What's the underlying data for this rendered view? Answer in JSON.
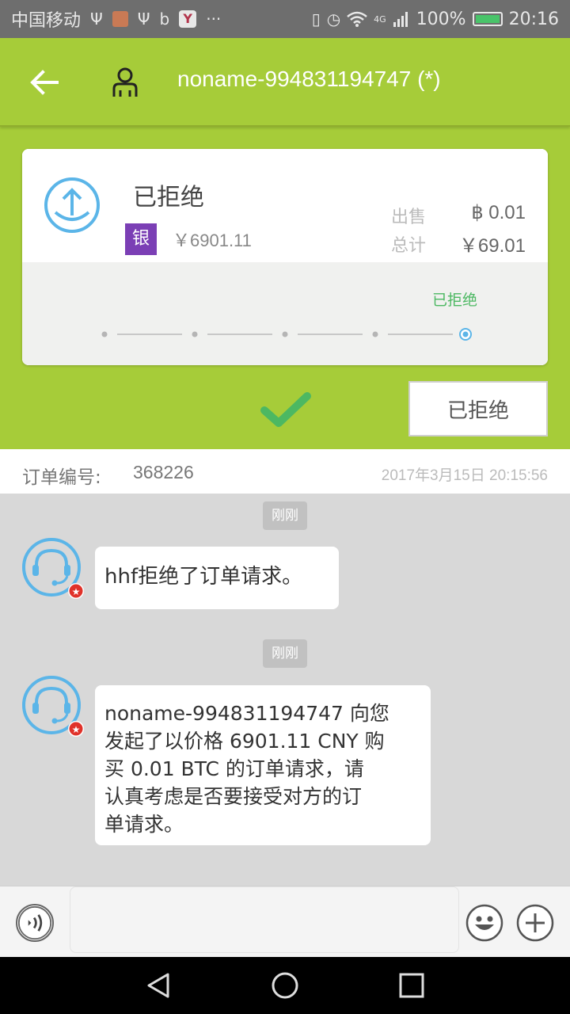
{
  "status_bar": {
    "carrier": "中国移动",
    "battery": "100%",
    "time": "20:16",
    "network": "4G",
    "icons": [
      "usb-icon",
      "app-icon",
      "usb-icon",
      "b-icon",
      "yahoo-icon",
      "more-icon",
      "vibrate-icon",
      "alarm-icon",
      "wifi-icon",
      "signal-icon",
      "battery-icon"
    ]
  },
  "app_bar": {
    "title": "noname-994831194747 (*)",
    "back_icon": "back-arrow-icon",
    "person_icon": "person-icon"
  },
  "order_card": {
    "status": "已拒绝",
    "bank_badge": "银",
    "unit_price": "￥6901.11",
    "sell_label": "出售",
    "sell_value": "฿ 0.01",
    "total_label": "总计",
    "total_value": "￥69.01",
    "progress_label": "已拒绝",
    "progress_steps": 5,
    "progress_current_step": 5
  },
  "actions": {
    "reject_button": "已拒绝"
  },
  "order_info": {
    "label": "订单编号:",
    "number": "368226",
    "time": "2017年3月15日 20:15:56"
  },
  "messages": [
    {
      "time": "刚刚",
      "text": "hhf拒绝了订单请求。"
    },
    {
      "time": "刚刚",
      "lines": [
        "noname-994831194747 向您",
        "发起了以价格 6901.11 CNY 购",
        "买 0.01 BTC 的订单请求，请",
        "认真考虑是否要接受对方的订",
        "单请求。"
      ]
    }
  ],
  "input": {
    "placeholder": ""
  },
  "colors": {
    "green": "#a6cc39",
    "accent_blue": "#5bb5e8",
    "check_green": "#4cb862",
    "bank_purple": "#7b3fb5",
    "badge_red": "#e0322a"
  }
}
